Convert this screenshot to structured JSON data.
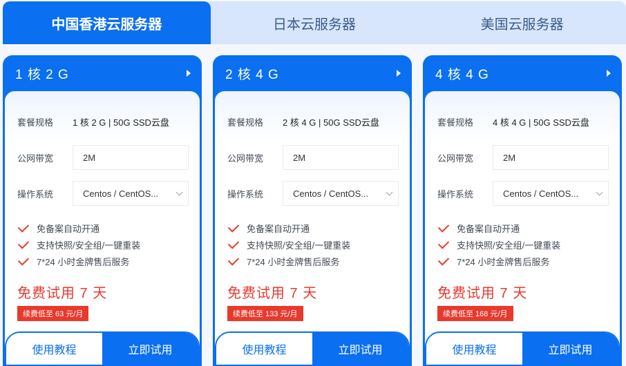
{
  "tabs": [
    {
      "label": "中国香港云服务器",
      "active": true
    },
    {
      "label": "日本云服务器",
      "active": false
    },
    {
      "label": "美国云服务器",
      "active": false
    }
  ],
  "colors": {
    "accent": "#0a6ff0",
    "price": "#e8392c",
    "tab_bg": "#d7e6fc"
  },
  "labels": {
    "spec": "套餐规格",
    "bandwidth": "公网带宽",
    "os": "操作系统"
  },
  "features": [
    "免备案自动开通",
    "支持快照/安全组/一键重装",
    "7*24 小时金牌售后服务"
  ],
  "cards": [
    {
      "title": "1 核 2 G",
      "spec": "1 核 2 G | 50G SSD云盘",
      "bandwidth": "2M",
      "os": "Centos / CentOS...",
      "trial": "免费试用 7 天",
      "renew": "续费低至 63 元/月",
      "guide_button": "使用教程",
      "try_button": "立即试用"
    },
    {
      "title": "2 核 4 G",
      "spec": "2 核 4 G | 50G SSD云盘",
      "bandwidth": "2M",
      "os": "Centos / CentOS...",
      "trial": "免费试用 7 天",
      "renew": "续费低至 133 元/月",
      "guide_button": "使用教程",
      "try_button": "立即试用"
    },
    {
      "title": "4 核 4 G",
      "spec": "4 核 4 G | 50G SSD云盘",
      "bandwidth": "2M",
      "os": "Centos / CentOS...",
      "trial": "免费试用 7 天",
      "renew": "续费低至 168 元/月",
      "guide_button": "使用教程",
      "try_button": "立即试用"
    }
  ]
}
